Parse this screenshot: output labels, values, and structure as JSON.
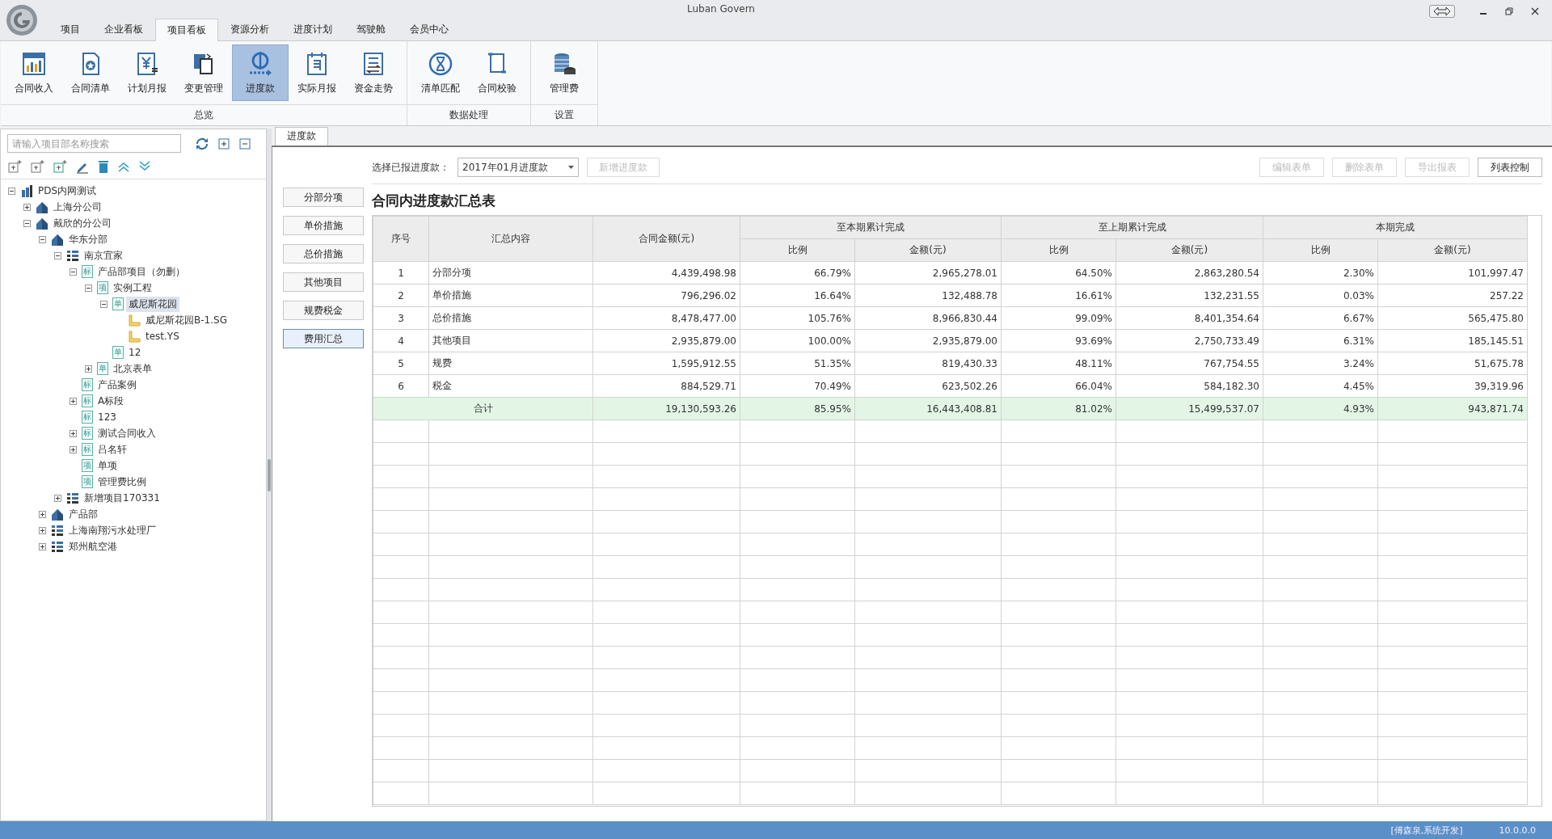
{
  "window": {
    "title": "Luban Govern"
  },
  "menu_tabs": [
    {
      "label": "项目",
      "selected": false
    },
    {
      "label": "企业看板",
      "selected": false
    },
    {
      "label": "项目看板",
      "selected": true
    },
    {
      "label": "资源分析",
      "selected": false
    },
    {
      "label": "进度计划",
      "selected": false
    },
    {
      "label": "驾驶舱",
      "selected": false
    },
    {
      "label": "会员中心",
      "selected": false
    }
  ],
  "ribbon": {
    "groups": [
      {
        "label": "总览",
        "buttons": [
          {
            "label": "合同收入",
            "kind": "chart",
            "selected": false
          },
          {
            "label": "合同清单",
            "kind": "document",
            "selected": false
          },
          {
            "label": "计划月报",
            "kind": "ledger",
            "selected": false
          },
          {
            "label": "变更管理",
            "kind": "copy",
            "selected": false
          },
          {
            "label": "进度款",
            "kind": "coin",
            "selected": true
          },
          {
            "label": "实际月报",
            "kind": "calendar",
            "selected": false
          },
          {
            "label": "资金走势",
            "kind": "transfer",
            "selected": false
          }
        ]
      },
      {
        "label": "数据处理",
        "buttons": [
          {
            "label": "清单匹配",
            "kind": "hourglass",
            "selected": false
          },
          {
            "label": "合同校验",
            "kind": "scroll",
            "selected": false
          }
        ]
      },
      {
        "label": "设置",
        "buttons": [
          {
            "label": "管理费",
            "kind": "stack",
            "selected": false
          }
        ]
      }
    ]
  },
  "sidebar": {
    "search": {
      "placeholder": "请输入项目部名称搜索"
    },
    "tree": [
      {
        "label": "PDS内网测试",
        "kind": "group",
        "expanded": true,
        "selected": false,
        "children": [
          {
            "label": "上海分公司",
            "kind": "company",
            "expanded": false,
            "selected": false
          },
          {
            "label": "戴欣的分公司",
            "kind": "company",
            "expanded": true,
            "selected": false,
            "children": [
              {
                "label": "华东分部",
                "kind": "company",
                "expanded": true,
                "selected": false,
                "children": [
                  {
                    "label": "南京宜家",
                    "kind": "list",
                    "expanded": true,
                    "selected": false,
                    "children": [
                      {
                        "label": "产品部项目（勿删）",
                        "kind": "badge",
                        "badge": "标",
                        "expanded": true,
                        "selected": false,
                        "children": [
                          {
                            "label": "实例工程",
                            "kind": "badge",
                            "badge": "项",
                            "expanded": true,
                            "selected": false,
                            "children": [
                              {
                                "label": "威尼斯花园",
                                "kind": "badge",
                                "badge": "单",
                                "expanded": true,
                                "selected": true,
                                "children": [
                                  {
                                    "label": "威尼斯花园B-1.SG",
                                    "kind": "file",
                                    "selected": false
                                  },
                                  {
                                    "label": "test.YS",
                                    "kind": "file",
                                    "selected": false
                                  }
                                ]
                              },
                              {
                                "label": "12",
                                "kind": "badge",
                                "badge": "单",
                                "selected": false
                              }
                            ]
                          },
                          {
                            "label": "北京表单",
                            "kind": "badge",
                            "badge": "单",
                            "expanded": false,
                            "selected": false
                          }
                        ]
                      },
                      {
                        "label": "产品案例",
                        "kind": "badge",
                        "badge": "标",
                        "selected": false
                      },
                      {
                        "label": "A标段",
                        "kind": "badge",
                        "badge": "标",
                        "expanded": false,
                        "selected": false
                      },
                      {
                        "label": "123",
                        "kind": "badge",
                        "badge": "标",
                        "selected": false
                      },
                      {
                        "label": "测试合同收入",
                        "kind": "badge",
                        "badge": "标",
                        "expanded": false,
                        "selected": false
                      },
                      {
                        "label": "吕名轩",
                        "kind": "badge",
                        "badge": "标",
                        "expanded": false,
                        "selected": false
                      },
                      {
                        "label": "单项",
                        "kind": "badge",
                        "badge": "项",
                        "selected": false
                      },
                      {
                        "label": "管理费比例",
                        "kind": "badge",
                        "badge": "项",
                        "selected": false
                      }
                    ]
                  },
                  {
                    "label": "新增项目170331",
                    "kind": "list",
                    "expanded": false,
                    "selected": false
                  }
                ]
              },
              {
                "label": "产品部",
                "kind": "company",
                "expanded": false,
                "selected": false
              },
              {
                "label": "上海南翔污水处理厂",
                "kind": "list",
                "expanded": false,
                "selected": false
              },
              {
                "label": "郑州航空港",
                "kind": "list",
                "expanded": false,
                "selected": false
              }
            ]
          }
        ]
      }
    ]
  },
  "content": {
    "tab": {
      "label": "进度款",
      "selected": true
    },
    "report_label": "选择已报进度款：",
    "report_select": {
      "value": "2017年01月进度款"
    },
    "add_button": {
      "label": "新增进度款",
      "disabled": true
    },
    "actions": [
      {
        "label": "编辑表单",
        "disabled": true
      },
      {
        "label": "删除表单",
        "disabled": true
      },
      {
        "label": "导出报表",
        "disabled": true
      },
      {
        "label": "列表控制",
        "disabled": false
      }
    ],
    "nav": [
      {
        "label": "分部分项",
        "selected": false
      },
      {
        "label": "单价措施",
        "selected": false
      },
      {
        "label": "总价措施",
        "selected": false
      },
      {
        "label": "其他项目",
        "selected": false
      },
      {
        "label": "规费税金",
        "selected": false
      },
      {
        "label": "费用汇总",
        "selected": true
      }
    ],
    "table": {
      "title": "合同内进度款汇总表",
      "columns": [
        "序号",
        "汇总内容",
        "合同金额(元)"
      ],
      "column_groups": [
        {
          "label": "至本期累计完成",
          "columns": [
            "比例",
            "金额(元)"
          ]
        },
        {
          "label": "至上期累计完成",
          "columns": [
            "比例",
            "金额(元)"
          ]
        },
        {
          "label": "本期完成",
          "columns": [
            "比例",
            "金额(元)"
          ]
        }
      ],
      "rows": [
        {
          "cells": [
            "1",
            "分部分项",
            "4,439,498.98",
            "66.79%",
            "2,965,278.01",
            "64.50%",
            "2,863,280.54",
            "2.30%",
            "101,997.47"
          ]
        },
        {
          "cells": [
            "2",
            "单价措施",
            "796,296.02",
            "16.64%",
            "132,488.78",
            "16.61%",
            "132,231.55",
            "0.03%",
            "257.22"
          ]
        },
        {
          "cells": [
            "3",
            "总价措施",
            "8,478,477.00",
            "105.76%",
            "8,966,830.44",
            "99.09%",
            "8,401,354.64",
            "6.67%",
            "565,475.80"
          ]
        },
        {
          "cells": [
            "4",
            "其他项目",
            "2,935,879.00",
            "100.00%",
            "2,935,879.00",
            "93.69%",
            "2,750,733.49",
            "6.31%",
            "185,145.51"
          ]
        },
        {
          "cells": [
            "5",
            "规费",
            "1,595,912.55",
            "51.35%",
            "819,430.33",
            "48.11%",
            "767,754.55",
            "3.24%",
            "51,675.78"
          ]
        },
        {
          "cells": [
            "6",
            "税金",
            "884,529.71",
            "70.49%",
            "623,502.26",
            "66.04%",
            "584,182.30",
            "4.45%",
            "39,319.96"
          ]
        }
      ],
      "total": {
        "label": "合计",
        "values": [
          "19,130,593.26",
          "85.95%",
          "16,443,408.81",
          "81.02%",
          "15,499,537.07",
          "4.93%",
          "943,871.74"
        ]
      }
    }
  },
  "status_bar": {
    "user": "[傅森泉,系统开发]",
    "version": "10.0.0.0"
  }
}
